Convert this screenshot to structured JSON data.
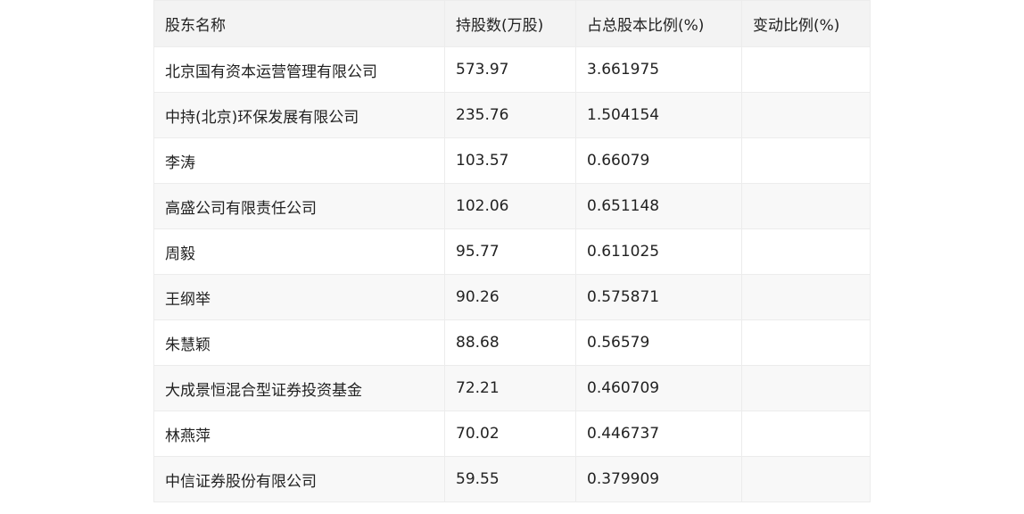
{
  "table": {
    "headers": [
      "股东名称",
      "持股数(万股)",
      "占总股本比例(%)",
      "变动比例(%)"
    ],
    "rows": [
      [
        "北京国有资本运营管理有限公司",
        "573.97",
        "3.661975",
        ""
      ],
      [
        "中持(北京)环保发展有限公司",
        "235.76",
        "1.504154",
        ""
      ],
      [
        "李涛",
        "103.57",
        "0.66079",
        ""
      ],
      [
        "高盛公司有限责任公司",
        "102.06",
        "0.651148",
        ""
      ],
      [
        "周毅",
        "95.77",
        "0.611025",
        ""
      ],
      [
        "王纲举",
        "90.26",
        "0.575871",
        ""
      ],
      [
        "朱慧颖",
        "88.68",
        "0.56579",
        ""
      ],
      [
        "大成景恒混合型证券投资基金",
        "72.21",
        "0.460709",
        ""
      ],
      [
        "林燕萍",
        "70.02",
        "0.446737",
        ""
      ],
      [
        "中信证券股份有限公司",
        "59.55",
        "0.379909",
        ""
      ]
    ]
  }
}
